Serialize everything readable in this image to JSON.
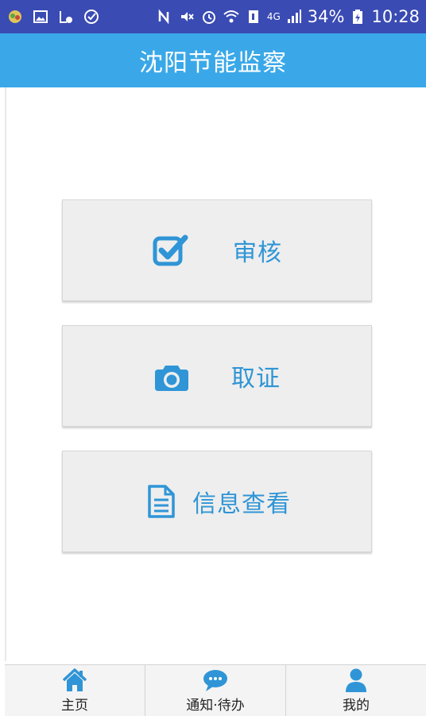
{
  "status_bar": {
    "network": "4G",
    "battery": "34%",
    "time": "10:28"
  },
  "header": {
    "title": "沈阳节能监察"
  },
  "menu": {
    "review_label": "审核",
    "evidence_label": "取证",
    "info_label": "信息查看"
  },
  "tabs": [
    {
      "label": "主页",
      "icon": "home-icon"
    },
    {
      "label": "通知·待办",
      "icon": "chat-bubble-icon"
    },
    {
      "label": "我的",
      "icon": "user-icon"
    }
  ],
  "colors": {
    "status_bar": "#3a4bb3",
    "app_bar": "#3aa8e8",
    "accent_blue": "#2f95d6",
    "button_bg": "#eeeeee"
  }
}
